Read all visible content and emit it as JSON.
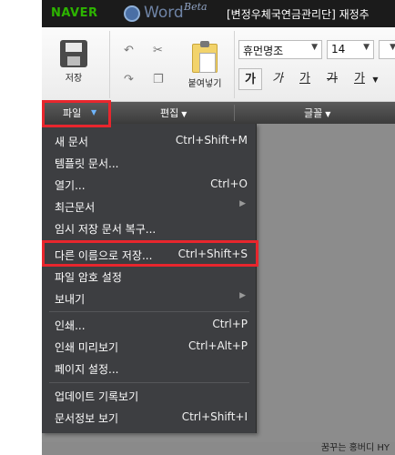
{
  "titlebar": {
    "naver_logo": "NAVER",
    "word_logo": "Word",
    "beta": "Beta",
    "title": "[변정우체국연금관리단] 재정추"
  },
  "ribbon": {
    "save_label": "저장",
    "paste_label": "붙여넣기",
    "font_name": "휴먼명조",
    "font_size": "14",
    "format_buttons": [
      "가",
      "가",
      "가",
      "가",
      "가"
    ]
  },
  "groups": {
    "file": "파일",
    "edit": "편집",
    "font": "글꼴"
  },
  "file_menu": {
    "items": [
      {
        "label": "새 문서",
        "shortcut": "Ctrl+Shift+M"
      },
      {
        "label": "템플릿 문서...",
        "shortcut": ""
      },
      {
        "label": "열기...",
        "shortcut": "Ctrl+O"
      },
      {
        "label": "최근문서",
        "shortcut": ""
      },
      {
        "label": "임시 저장 문서 복구...",
        "shortcut": ""
      },
      {
        "label": "다른 이름으로 저장...",
        "shortcut": "Ctrl+Shift+S"
      },
      {
        "label": "파일 암호 설정",
        "shortcut": ""
      },
      {
        "label": "보내기",
        "shortcut": ""
      },
      {
        "label": "인쇄...",
        "shortcut": "Ctrl+P"
      },
      {
        "label": "인쇄 미리보기",
        "shortcut": "Ctrl+Alt+P"
      },
      {
        "label": "페이지 설정...",
        "shortcut": ""
      },
      {
        "label": "업데이트 기록보기",
        "shortcut": ""
      },
      {
        "label": "문서정보 보기",
        "shortcut": "Ctrl+Shift+I"
      }
    ]
  },
  "watermark": "꿈꾸는 홍버디 HY",
  "colors": {
    "highlight_box": "#e8262d",
    "menu_bg": "#3d3e41",
    "title_bg": "#1b1b1b",
    "naver_green": "#2db400"
  }
}
